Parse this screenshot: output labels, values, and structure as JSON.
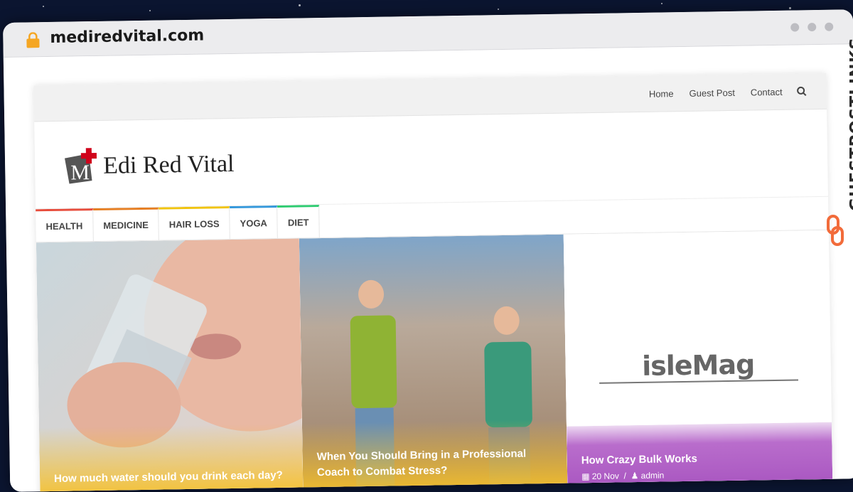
{
  "browser": {
    "url": "mediredvital.com"
  },
  "topbar": {
    "links": [
      "Home",
      "Guest Post",
      "Contact"
    ]
  },
  "logo": {
    "mark_letter": "M",
    "text": "Edi Red Vital"
  },
  "nav": {
    "items": [
      {
        "label": "HEALTH",
        "color": "#e74c3c"
      },
      {
        "label": "MEDICINE",
        "color": "#e67e22"
      },
      {
        "label": "HAIR LOSS",
        "color": "#f1c40f"
      },
      {
        "label": "YOGA",
        "color": "#3498db"
      },
      {
        "label": "DIET",
        "color": "#2ecc71"
      }
    ]
  },
  "cards": [
    {
      "title": "How much water should you drink each day?",
      "overlay_color": "#f6c12a"
    },
    {
      "title": "When You Should Bring in a Professional Coach to Combat Stress?",
      "overlay_color": "#f6c12a"
    },
    {
      "title": "How Crazy Bulk Works",
      "date": "20 Nov",
      "author": "admin",
      "overlay_color": "#b565c9",
      "placeholder_logo": "isleMag"
    }
  ],
  "watermark": {
    "text": "GUESTPOSTLINKS",
    "icon": "link-icon"
  },
  "colors": {
    "lock": "#f5a623",
    "watermark_icon": "#f26b3a"
  }
}
